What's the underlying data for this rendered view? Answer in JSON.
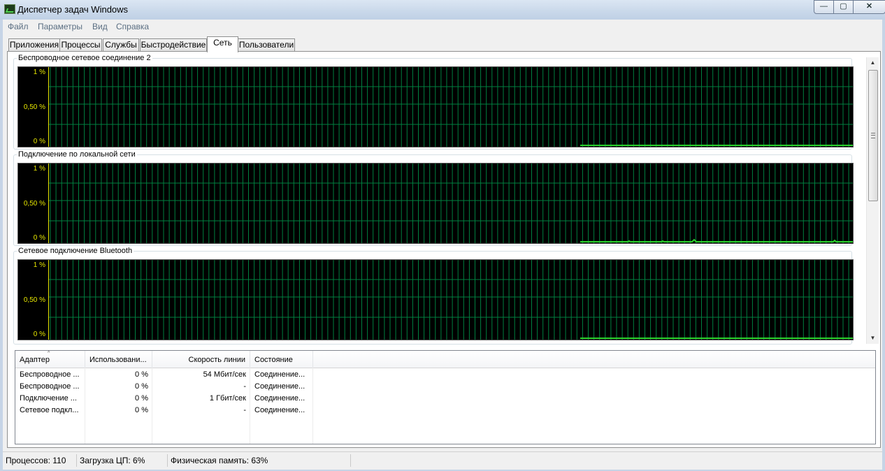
{
  "window": {
    "title": "Диспетчер задач Windows",
    "minimize_glyph": "—",
    "maximize_glyph": "▢",
    "close_glyph": "✕"
  },
  "menu": [
    "Файл",
    "Параметры",
    "Вид",
    "Справка"
  ],
  "tabs": [
    {
      "label": "Приложения"
    },
    {
      "label": "Процессы"
    },
    {
      "label": "Службы"
    },
    {
      "label": "Быстродействие"
    },
    {
      "label": "Сеть",
      "active": true
    },
    {
      "label": "Пользователи"
    }
  ],
  "graphs": [
    {
      "title": "Беспроводное сетевое соединение 2",
      "axis": [
        "1 %",
        "0,50 %",
        "0 %"
      ]
    },
    {
      "title": "Подключение по локальной сети",
      "axis": [
        "1 %",
        "0,50 %",
        "0 %"
      ]
    },
    {
      "title": "Сетевое подключение Bluetooth",
      "axis": [
        "1 %",
        "0,50 %",
        "0 %"
      ]
    }
  ],
  "colors": {
    "graph_bg": "#000000",
    "grid": "#008040",
    "axis": "#e6e600",
    "trace": "#2bd12b"
  },
  "scrollbar": {
    "up_glyph": "▲",
    "down_glyph": "▼"
  },
  "list": {
    "sort_glyph": "^",
    "columns": [
      "Адаптер",
      "Использовани...",
      "Скорость линии",
      "Состояние"
    ],
    "rows": [
      [
        "Беспроводное ...",
        "0 %",
        "54 Мбит/сек",
        "Соединение..."
      ],
      [
        "Беспроводное ...",
        "0 %",
        "-",
        "Соединение..."
      ],
      [
        "Подключение ...",
        "0 %",
        "1 Гбит/сек",
        "Соединение..."
      ],
      [
        "Сетевое подкл...",
        "0 %",
        "-",
        "Соединение..."
      ]
    ]
  },
  "status": {
    "processes": "Процессов: 110",
    "cpu": "Загрузка ЦП: 6%",
    "memory": "Физическая память: 63%"
  }
}
